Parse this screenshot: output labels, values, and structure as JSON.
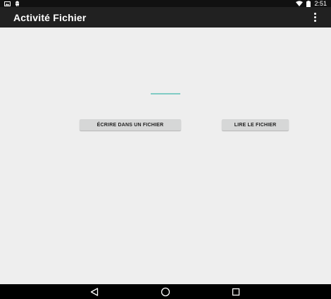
{
  "status_bar": {
    "time": "2:51",
    "left_icons": [
      "image-notification-icon",
      "android-notification-icon"
    ],
    "right_icons": [
      "wifi-icon",
      "battery-icon"
    ]
  },
  "action_bar": {
    "title": "Activité Fichier",
    "overflow_icon": "overflow-menu-icon"
  },
  "main": {
    "text_field_value": "",
    "write_button_label": "ÉCRIRE DANS UN FICHIER",
    "read_button_label": "LIRE LE FICHIER"
  },
  "nav_bar": {
    "icons": [
      "back-icon",
      "home-icon",
      "recents-icon"
    ]
  },
  "colors": {
    "status_bar": "#111111",
    "action_bar": "#212121",
    "background": "#eeeeee",
    "button": "#d6d7d7",
    "accent_underline": "#80cbc4",
    "nav_bar": "#000000"
  }
}
